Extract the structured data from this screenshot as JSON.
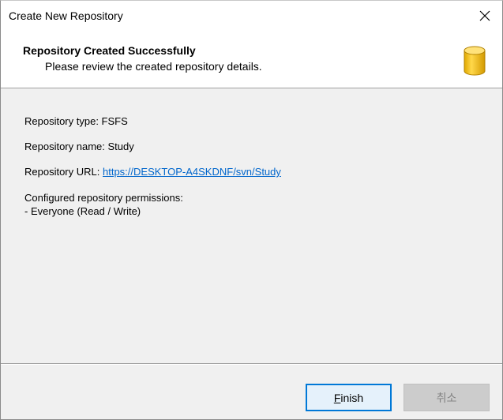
{
  "window": {
    "title": "Create New Repository"
  },
  "header": {
    "title": "Repository Created Successfully",
    "subtitle": "Please review the created repository details.",
    "icon": "database-icon",
    "icon_color": "#f2c200"
  },
  "details": {
    "type_label": "Repository type: FSFS",
    "name_label": "Repository name: Study",
    "url_prefix": "Repository URL:",
    "url_value": "https://DESKTOP-A4SKDNF/svn/Study",
    "permissions_heading": "Configured repository permissions:",
    "permissions_entry": "- Everyone (Read / Write)"
  },
  "buttons": {
    "finish_accel": "F",
    "finish_rest": "inish",
    "cancel_label": "취소"
  },
  "colors": {
    "link": "#0066cc",
    "focus_border": "#0078d7",
    "disabled_bg": "#cccccc"
  }
}
